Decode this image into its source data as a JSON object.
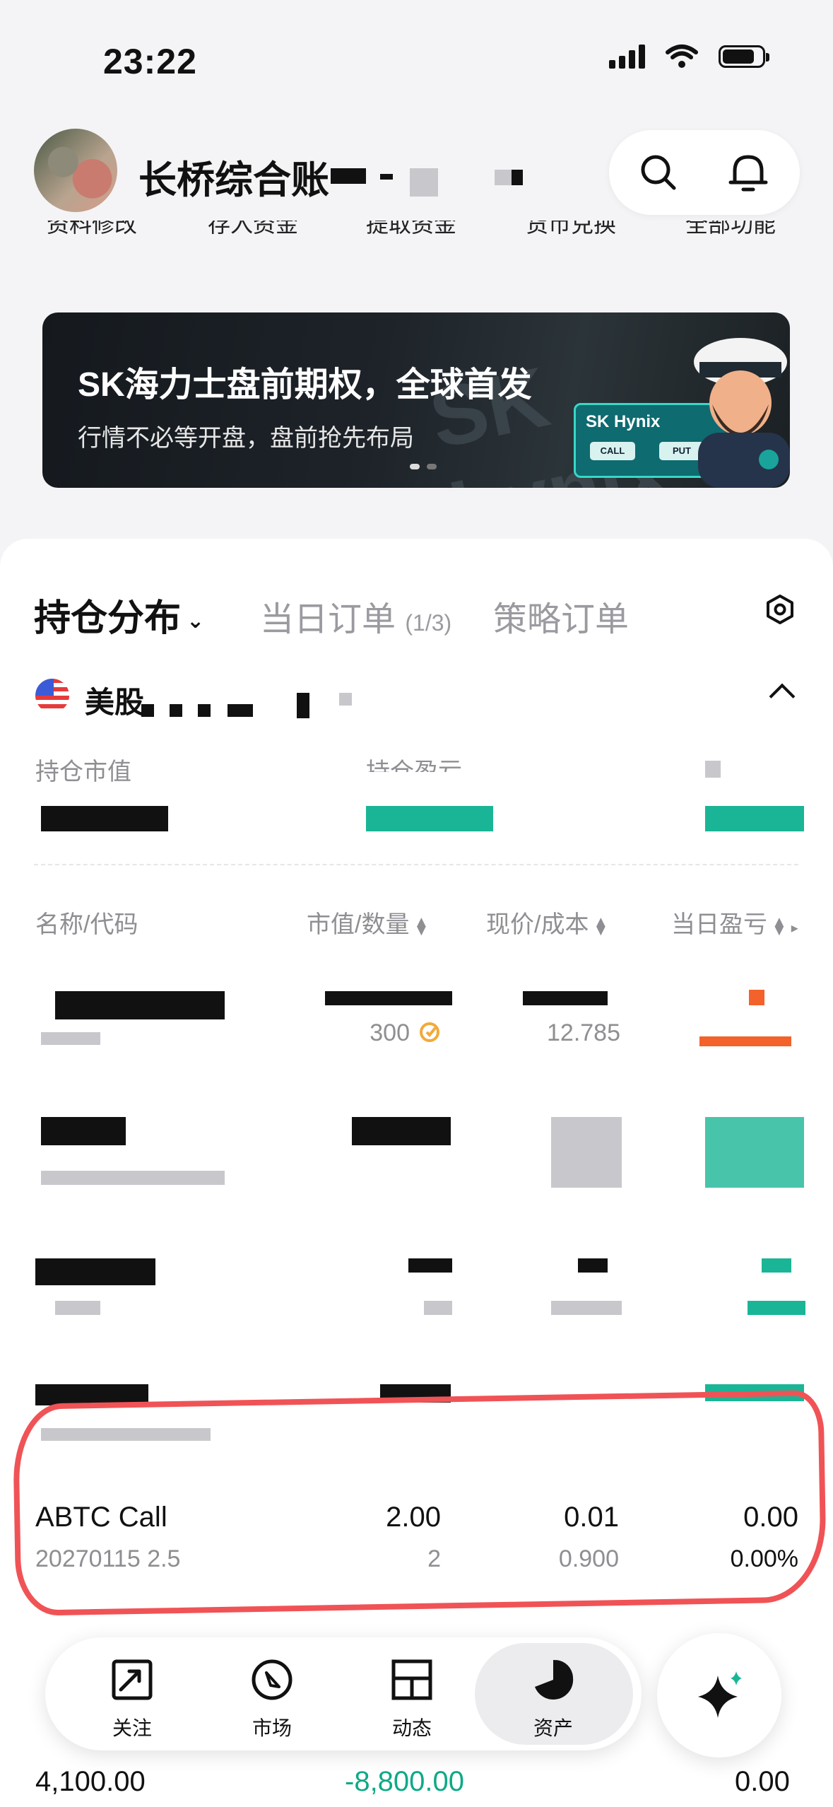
{
  "status_bar": {
    "time": "23:22"
  },
  "header": {
    "account_name": "长桥综合账",
    "shortcuts": [
      "资料修改",
      "存入资金",
      "提取资金",
      "货币兑换",
      "全部功能"
    ]
  },
  "banner": {
    "title": "SK海力士盘前期权，全球首发",
    "subtitle": "行情不必等开盘，盘前抢先布局",
    "bg_text": "SK hynix",
    "card_title": "SK Hynix",
    "card_buttons": [
      "CALL",
      "PUT"
    ]
  },
  "tabs": {
    "positions": "持仓分布",
    "today_orders": "当日订单",
    "today_orders_count": "(1/3)",
    "strategy_orders": "策略订单"
  },
  "market": {
    "label": "美股",
    "market_value_label": "持仓市值",
    "pnl_label": "持仓盈亏"
  },
  "columns": {
    "name": "名称/代码",
    "value_qty": "市值/数量",
    "price_cost": "现价/成本",
    "daily_pnl": "当日盈亏"
  },
  "rows": [
    {
      "qty": "300",
      "cost": "12.785"
    }
  ],
  "highlighted_row": {
    "name": "ABTC Call",
    "code": "20270115 2.5",
    "market_value": "2.00",
    "quantity": "2",
    "price": "0.01",
    "cost": "0.900",
    "daily_pnl": "0.00",
    "daily_pnl_pct": "0.00%"
  },
  "bottom_summary": {
    "market_value": "4,100.00",
    "pnl": "-8,800.00",
    "daily_pnl": "0.00"
  },
  "nav": {
    "items": [
      "关注",
      "市场",
      "动态",
      "资产"
    ],
    "active": "资产"
  },
  "colors": {
    "accent_green": "#0fa987",
    "annotation_red": "#f05356",
    "loss_orange": "#f2622a"
  }
}
